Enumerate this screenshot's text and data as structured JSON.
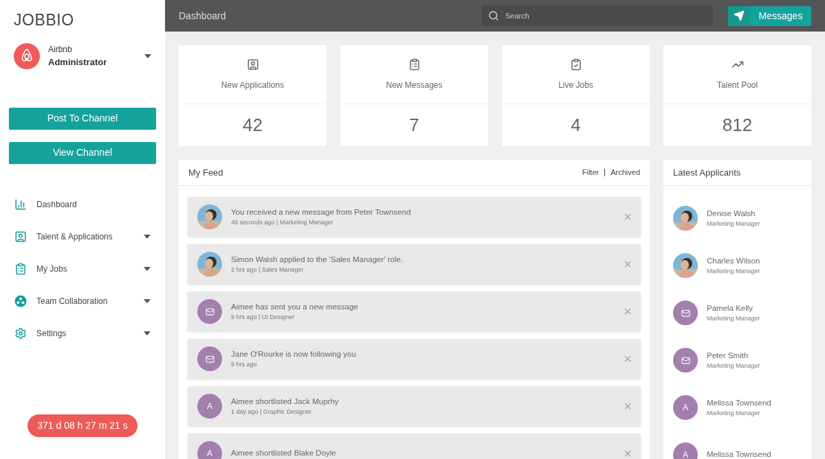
{
  "brand": "JOBBIO",
  "account": {
    "company": "Airbnb",
    "role": "Administrator"
  },
  "actions": [
    "Post To Channel",
    "View Channel"
  ],
  "nav": [
    {
      "label": "Dashboard",
      "submenu": false
    },
    {
      "label": "Talent & Applications",
      "submenu": true
    },
    {
      "label": "My Jobs",
      "submenu": true
    },
    {
      "label": "Team Collaboration",
      "submenu": true
    },
    {
      "label": "Settings",
      "submenu": true
    }
  ],
  "timer": "371 d 08 h 27 m 21 s",
  "header": {
    "title": "Dashboard",
    "search_placeholder": "Search",
    "messages_button": "Messages"
  },
  "stats": [
    {
      "label": "New Applications",
      "value": "42"
    },
    {
      "label": "New Messages",
      "value": "7"
    },
    {
      "label": "Live Jobs",
      "value": "4"
    },
    {
      "label": "Talent Pool",
      "value": "812"
    }
  ],
  "feed": {
    "title": "My Feed",
    "links": [
      "Filter",
      "Archived"
    ],
    "items": [
      {
        "text": "You received a new message from Peter Townsend",
        "meta": "46 seconds ago | Marketing Manager"
      },
      {
        "text": "Simon Walsh applied to the 'Sales Manager' role.",
        "meta": "2 hrs ago | Sales Manager"
      },
      {
        "avatar": {
          "kind": "mail"
        },
        "text": "Aimee has sent you a new message",
        "meta": "9 hrs ago | UI Designer"
      },
      {
        "avatar": {
          "kind": "mail"
        },
        "text": "Jane O'Rourke is now following you",
        "meta": "9 hrs ago"
      },
      {
        "avatar": {
          "kind": "letter",
          "letter": "A"
        },
        "text": "Aimee shortlisted Jack Muprhy",
        "meta": "1 day ago | Graphic Designer"
      },
      {
        "avatar": {
          "kind": "letter",
          "letter": "A"
        },
        "text": "Aimee shortlisted Blake Doyle"
      }
    ]
  },
  "applicants": {
    "title": "Latest Applicants",
    "items": [
      {
        "name": "Denise Walsh",
        "role": "Marketing Manager"
      },
      {
        "name": "Charles Wilson",
        "role": "Marketing Manager"
      },
      {
        "avatar": {
          "kind": "mail"
        },
        "name": "Pamela Kelly",
        "role": "Marketing Manager"
      },
      {
        "avatar": {
          "kind": "mail"
        },
        "name": "Peter Smith",
        "role": "Marketing Manager"
      },
      {
        "avatar": {
          "kind": "letter",
          "letter": "A"
        },
        "name": "Melissa Townsend",
        "role": "Marketing Manager"
      },
      {
        "avatar": {
          "kind": "letter",
          "letter": "A"
        },
        "name": "Melissa Townsend"
      }
    ]
  }
}
